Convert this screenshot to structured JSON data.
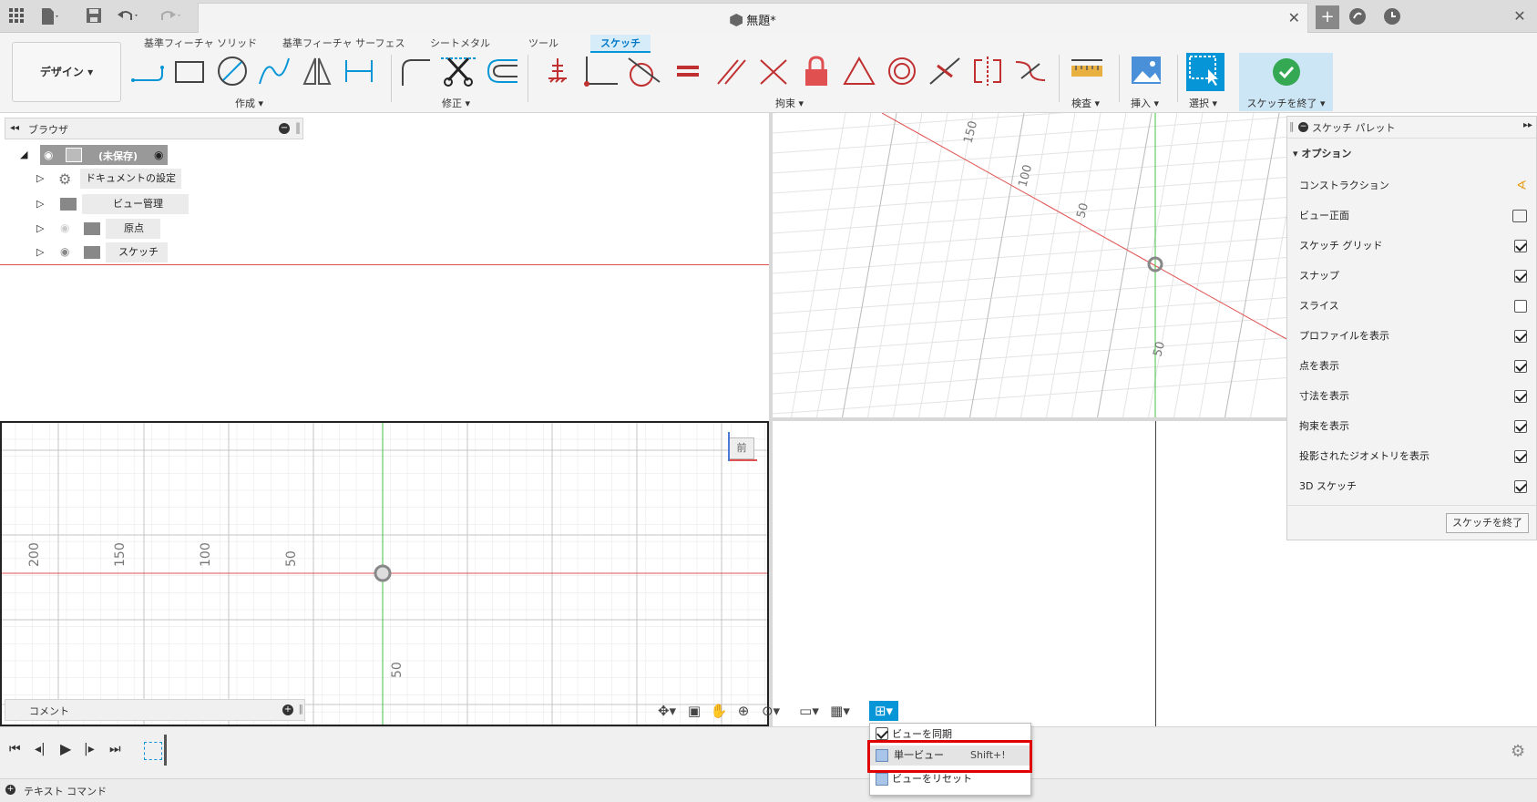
{
  "titlebar": {
    "document_title": "無題*",
    "icons": [
      "grid-menu-icon",
      "file-icon",
      "save-icon",
      "undo-icon",
      "redo-icon",
      "close-icon",
      "add-tab-icon",
      "online-icon",
      "clock-icon"
    ]
  },
  "toolbar": {
    "workspace": "デザイン",
    "tabs": [
      "基準フィーチャ ソリッド",
      "基準フィーチャ サーフェス",
      "シートメタル",
      "ツール",
      "スケッチ"
    ],
    "active_tab": "スケッチ",
    "groups": {
      "create": "作成",
      "modify": "修正",
      "constraints": "拘束",
      "inspect": "検査",
      "insert": "挿入",
      "select": "選択",
      "finish": "スケッチを終了"
    }
  },
  "browser": {
    "title": "ブラウザ",
    "root": "(未保存)",
    "items": [
      {
        "label": "ドキュメントの設定",
        "icon": "gear-icon"
      },
      {
        "label": "ビュー管理",
        "icon": "folder-icon"
      },
      {
        "label": "原点",
        "icon": "folder-icon"
      },
      {
        "label": "スケッチ",
        "icon": "folder-icon"
      }
    ]
  },
  "viewport_top_right": {
    "labels": [
      "150",
      "100",
      "50",
      "50"
    ]
  },
  "viewport_bottom_left": {
    "labels": [
      "200",
      "150",
      "100",
      "50",
      "50"
    ],
    "view_cube": "前"
  },
  "comments": {
    "label": "コメント"
  },
  "palette": {
    "title": "スケッチ パレット",
    "section": "オプション",
    "rows": [
      {
        "label": "コンストラクション",
        "type": "icon"
      },
      {
        "label": "ビュー正面",
        "type": "icon"
      },
      {
        "label": "スケッチ グリッド",
        "checked": true
      },
      {
        "label": "スナップ",
        "checked": true
      },
      {
        "label": "スライス",
        "checked": false
      },
      {
        "label": "プロファイルを表示",
        "checked": true
      },
      {
        "label": "点を表示",
        "checked": true
      },
      {
        "label": "寸法を表示",
        "checked": true
      },
      {
        "label": "拘束を表示",
        "checked": true
      },
      {
        "label": "投影されたジオメトリを表示",
        "checked": true
      },
      {
        "label": "3D スケッチ",
        "checked": true
      }
    ],
    "finish_button": "スケッチを終了"
  },
  "dropdown": {
    "sync": "ビューを同期",
    "single": "単一ビュー",
    "single_shortcut": "Shift+!",
    "reset": "ビューをリセット"
  },
  "statusbar": {
    "label": "テキスト コマンド"
  },
  "colors": {
    "accent": "#0696d7",
    "axis_red": "#e05050",
    "axis_green": "#40c040",
    "highlight": "#e00000",
    "finish_check": "#34a853"
  }
}
